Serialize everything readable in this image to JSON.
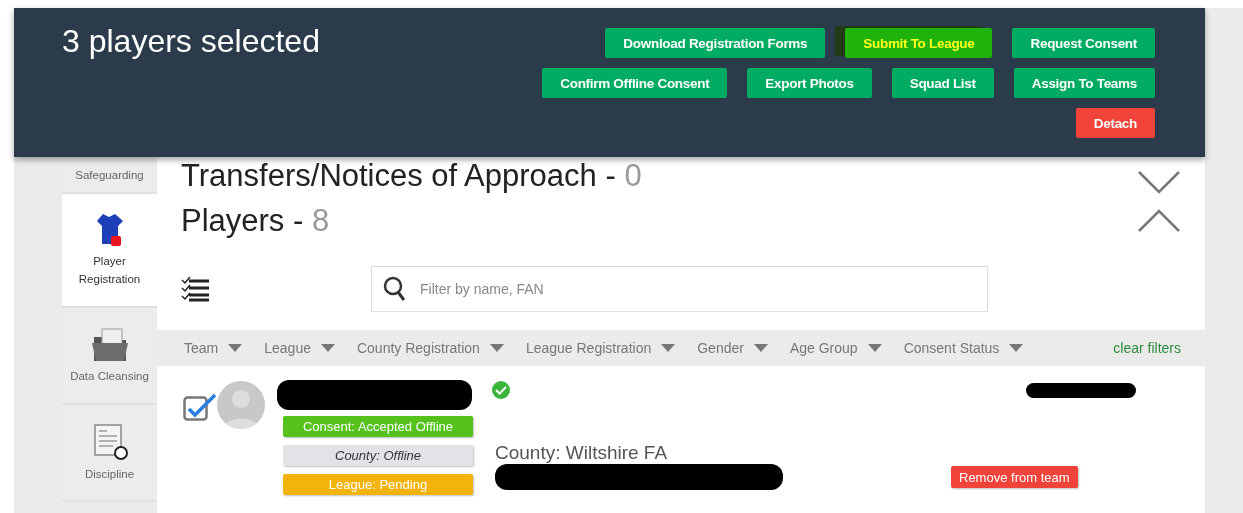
{
  "header": {
    "title": "3 players selected",
    "button_rows": [
      [
        {
          "label": "Download Registration Forms",
          "kind": "primary",
          "highlighted": false
        },
        {
          "label": "Submit To League",
          "kind": "primary",
          "highlighted": true
        },
        {
          "label": "Request Consent",
          "kind": "primary",
          "highlighted": false
        }
      ],
      [
        {
          "label": "Confirm Offline Consent",
          "kind": "primary",
          "highlighted": false
        },
        {
          "label": "Export Photos",
          "kind": "primary",
          "highlighted": false
        },
        {
          "label": "Squad List",
          "kind": "primary",
          "highlighted": false
        },
        {
          "label": "Assign To Teams",
          "kind": "primary",
          "highlighted": false
        }
      ],
      [
        {
          "label": "Detach",
          "kind": "danger",
          "highlighted": false
        }
      ]
    ]
  },
  "sidebar": {
    "items": [
      {
        "label": "Safeguarding",
        "selected": false
      },
      {
        "label": "Player Registration",
        "selected": true
      },
      {
        "label": "Data Cleansing",
        "selected": false
      },
      {
        "label": "Discipline",
        "selected": false
      }
    ]
  },
  "sections": [
    {
      "title": "Transfers/Notices of Approach",
      "separator": "-",
      "count": "0",
      "expanded": false
    },
    {
      "title": "Players",
      "separator": "-",
      "count": "8",
      "expanded": true
    }
  ],
  "search": {
    "placeholder": "Filter by name, FAN"
  },
  "filters": [
    {
      "label": "Team"
    },
    {
      "label": "League"
    },
    {
      "label": "County Registration"
    },
    {
      "label": "League Registration"
    },
    {
      "label": "Gender"
    },
    {
      "label": "Age Group"
    },
    {
      "label": "Consent Status"
    }
  ],
  "clear_filters": "clear filters",
  "player": {
    "checked": true,
    "verified": true,
    "badges": [
      {
        "label": "Consent: Accepted Offline",
        "kind": "consent"
      },
      {
        "label": "County: Offline",
        "kind": "county"
      },
      {
        "label": "League: Pending",
        "kind": "league"
      }
    ],
    "county": "County: Wiltshire FA",
    "remove_button": "Remove from team"
  }
}
